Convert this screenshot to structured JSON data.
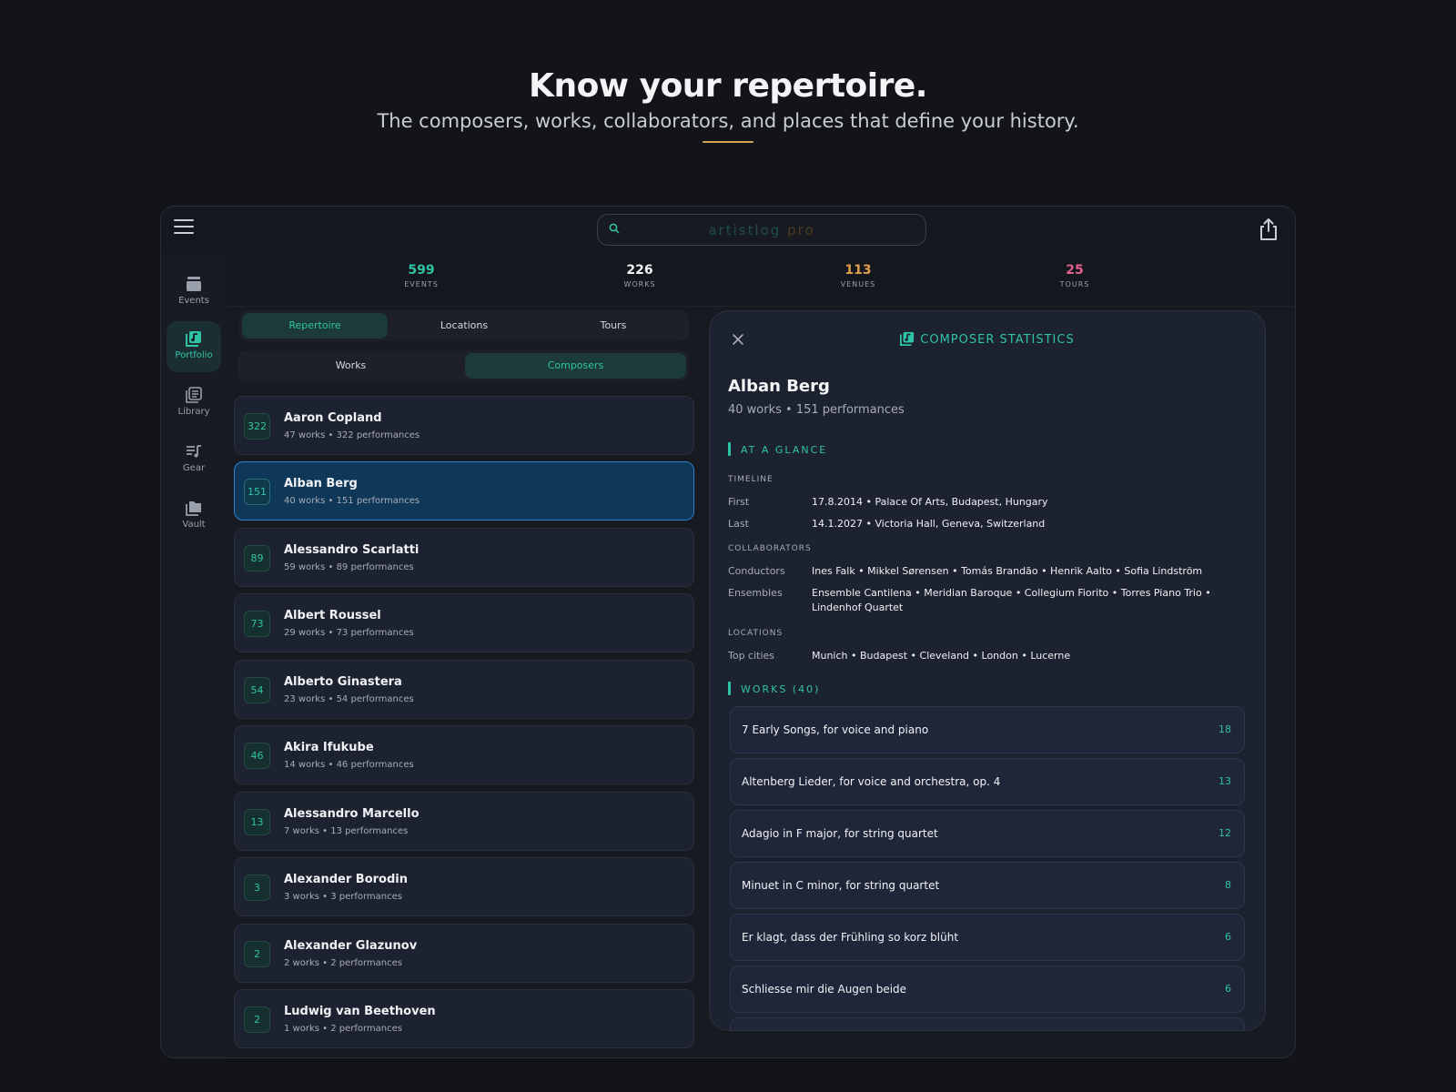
{
  "hero": {
    "title": "Know your repertoire.",
    "subtitle": "The composers, works, collaborators, and places that define your history."
  },
  "search": {
    "placeholder": "",
    "brand_a": "artistlog",
    "brand_b": "pro"
  },
  "sidebar": {
    "items": [
      {
        "label": "Events",
        "icon": "events-icon"
      },
      {
        "label": "Portfolio",
        "icon": "portfolio-icon",
        "active": true
      },
      {
        "label": "Library",
        "icon": "library-icon"
      },
      {
        "label": "Gear",
        "icon": "gear-icon"
      },
      {
        "label": "Vault",
        "icon": "vault-icon"
      }
    ]
  },
  "stats": [
    {
      "value": "599",
      "label": "EVENTS",
      "color": "#2fc3a5"
    },
    {
      "value": "226",
      "label": "WORKS",
      "color": "#f2f3f5"
    },
    {
      "value": "113",
      "label": "VENUES",
      "color": "#e0a04c"
    },
    {
      "value": "25",
      "label": "TOURS",
      "color": "#e5608a"
    }
  ],
  "tabs": {
    "repertoire": "Repertoire",
    "locations": "Locations",
    "tours": "Tours"
  },
  "subtabs": {
    "works": "Works",
    "composers": "Composers"
  },
  "composers": [
    {
      "count": "322",
      "name": "Aaron Copland",
      "meta": "47 works • 322 performances"
    },
    {
      "count": "151",
      "name": "Alban Berg",
      "meta": "40 works • 151 performances",
      "selected": true
    },
    {
      "count": "89",
      "name": "Alessandro Scarlatti",
      "meta": "59 works • 89 performances"
    },
    {
      "count": "73",
      "name": "Albert Roussel",
      "meta": "29 works • 73 performances"
    },
    {
      "count": "54",
      "name": "Alberto Ginastera",
      "meta": "23 works • 54 performances"
    },
    {
      "count": "46",
      "name": "Akira Ifukube",
      "meta": "14 works • 46 performances"
    },
    {
      "count": "13",
      "name": "Alessandro Marcello",
      "meta": "7 works • 13 performances"
    },
    {
      "count": "3",
      "name": "Alexander Borodin",
      "meta": "3 works • 3 performances"
    },
    {
      "count": "2",
      "name": "Alexander Glazunov",
      "meta": "2 works • 2 performances"
    },
    {
      "count": "2",
      "name": "Ludwig van Beethoven",
      "meta": "1 works • 2 performances"
    }
  ],
  "panel": {
    "header": "COMPOSER STATISTICS",
    "name": "Alban Berg",
    "summary": "40 works • 151 performances",
    "glance_title": "AT A GLANCE",
    "timeline_title": "TIMELINE",
    "first_label": "First",
    "first_value": "17.8.2014 • Palace Of Arts, Budapest, Hungary",
    "last_label": "Last",
    "last_value": "14.1.2027 • Victoria Hall, Geneva, Switzerland",
    "collab_title": "COLLABORATORS",
    "conductors_label": "Conductors",
    "conductors_value": "Ines Falk • Mikkel Sørensen • Tomás Brandão • Henrik Aalto • Sofia Lindström",
    "ensembles_label": "Ensembles",
    "ensembles_value": "Ensemble Cantilena • Meridian Baroque • Collegium Fiorito • Torres Piano Trio • Lindenhof Quartet",
    "locations_title": "LOCATIONS",
    "cities_label": "Top cities",
    "cities_value": "Munich • Budapest • Cleveland • London • Lucerne",
    "works_title": "WORKS (40)",
    "works": [
      {
        "title": "7 Early Songs, for voice and piano",
        "count": "18"
      },
      {
        "title": "Altenberg Lieder, for voice and orchestra, op. 4",
        "count": "13"
      },
      {
        "title": "Adagio in F major, for string quartet",
        "count": "12"
      },
      {
        "title": "Minuet in C minor, for string quartet",
        "count": "8"
      },
      {
        "title": "Er klagt, dass der Frühling so korz blüht",
        "count": "6"
      },
      {
        "title": "Schliesse mir die Augen beide",
        "count": "6"
      }
    ]
  }
}
